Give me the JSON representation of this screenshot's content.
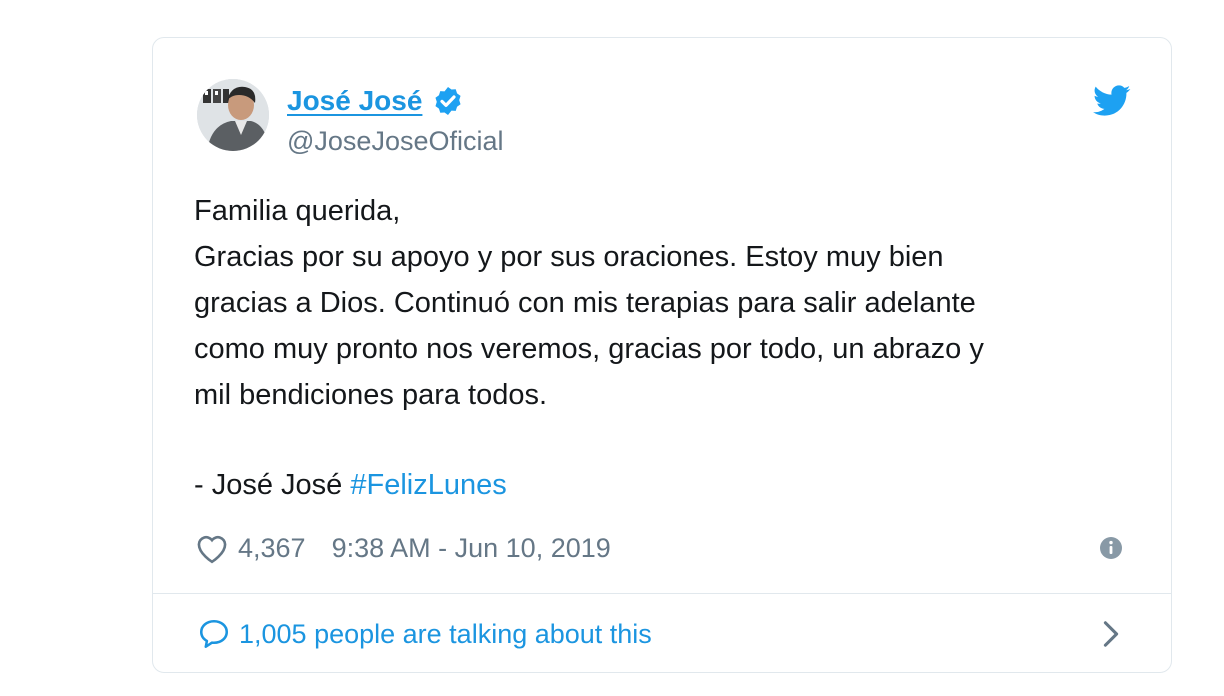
{
  "author": {
    "display_name": "José José",
    "handle": "@JoseJoseOficial",
    "verified": true,
    "avatar_icon": "profile-photo-avatar"
  },
  "tweet": {
    "lines": [
      "Familia querida,",
      "Gracias por su apoyo y por sus oraciones. Estoy muy bien",
      "gracias a Dios. Continuó con mis terapias para salir adelante",
      "como muy pronto nos veremos, gracias por todo, un abrazo y",
      "mil bendiciones para todos."
    ],
    "signature": "- José José",
    "hashtag": "#FelizLunes"
  },
  "meta": {
    "likes": "4,367",
    "timestamp": "9:38 AM - Jun 10, 2019"
  },
  "conversation": {
    "label": "1,005 people are talking about this"
  },
  "colors": {
    "accent": "#1b95e0",
    "muted": "#657786",
    "text": "#14171a",
    "border": "#e1e8ed"
  }
}
